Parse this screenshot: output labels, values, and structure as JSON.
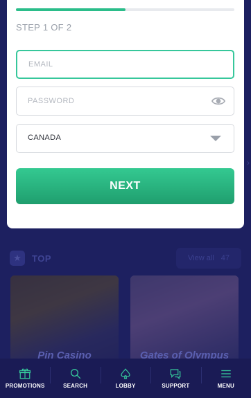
{
  "signup": {
    "progress_fraction": 0.5,
    "step_text": "STEP 1 OF 2",
    "email_placeholder": "EMAIL",
    "password_placeholder": "PASSWORD",
    "country_value": "CANADA",
    "next_label": "NEXT"
  },
  "lobby_section": {
    "title": "TOP",
    "view_all_label": "View all",
    "view_all_count": "47",
    "tiles": [
      {
        "title": "Pin Casino"
      },
      {
        "title": "Gates of Olympus"
      }
    ]
  },
  "bottom_nav": {
    "items": [
      {
        "label": "PROMOTIONS",
        "icon": "gift-icon"
      },
      {
        "label": "SEARCH",
        "icon": "search-icon"
      },
      {
        "label": "LOBBY",
        "icon": "spade-icon"
      },
      {
        "label": "SUPPORT",
        "icon": "chat-icon"
      },
      {
        "label": "MENU",
        "icon": "menu-icon"
      }
    ]
  },
  "colors": {
    "accent": "#2bbd8a",
    "background": "#1c1f5e",
    "nav_icon": "#36c79b"
  }
}
